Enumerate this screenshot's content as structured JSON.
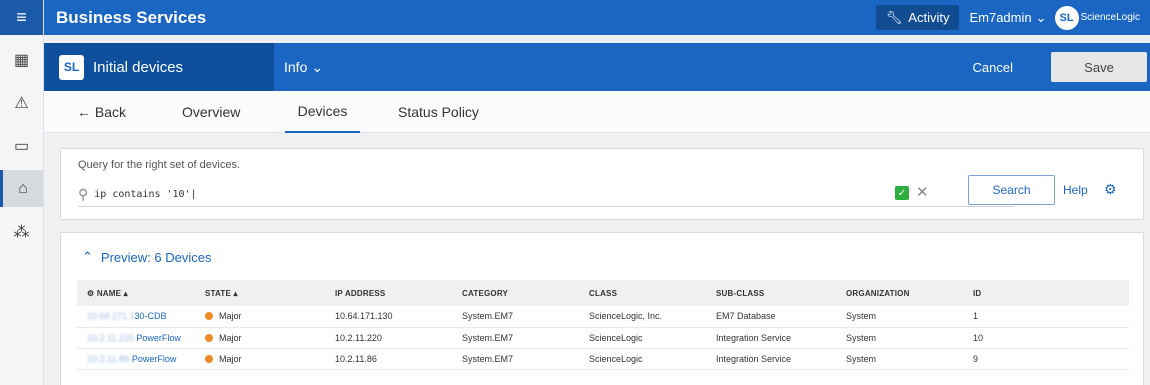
{
  "app": {
    "title": "Business Services",
    "activity_label": "Activity",
    "user_label": "Em7admin",
    "logo_mark": "SL",
    "logo_text": "ScienceLogic"
  },
  "service": {
    "icon_text": "SL",
    "name": "Initial devices",
    "info_label": "Info",
    "cancel_label": "Cancel",
    "save_label": "Save"
  },
  "tabs": {
    "back_label": "← Back",
    "items": [
      "Overview",
      "Devices",
      "Status Policy"
    ],
    "active": "Devices"
  },
  "query": {
    "label": "Query for the right set of devices.",
    "value": "ip contains '10'|",
    "search_label": "Search",
    "help_label": "Help"
  },
  "preview": {
    "title": "Preview: 6 Devices",
    "columns": [
      "NAME ▴",
      "STATE ▴",
      "IP ADDRESS",
      "CATEGORY",
      "CLASS",
      "SUB-CLASS",
      "ORGANIZATION",
      "ID"
    ],
    "rows": [
      {
        "name_prefix": "10.64.171.1",
        "name_suffix": "30-CDB",
        "state": "Major",
        "ip": "10.64.171.130",
        "category": "System.EM7",
        "class": "ScienceLogic, Inc.",
        "subclass": "EM7 Database",
        "org": "System",
        "id": "1"
      },
      {
        "name_prefix": "10.2.11.220",
        "name_suffix": "PowerFlow",
        "state": "Major",
        "ip": "10.2.11.220",
        "category": "System.EM7",
        "class": "ScienceLogic",
        "subclass": "Integration Service",
        "org": "System",
        "id": "10"
      },
      {
        "name_prefix": "10.2.11.86-",
        "name_suffix": "PowerFlow",
        "state": "Major",
        "ip": "10.2.11.86",
        "category": "System.EM7",
        "class": "ScienceLogic",
        "subclass": "Integration Service",
        "org": "System",
        "id": "9"
      }
    ]
  },
  "colors": {
    "brand": "#1a66c2",
    "brand_dark": "#0e4f9e",
    "major": "#f08a24",
    "valid": "#2eae3e"
  },
  "icons": {
    "rail": [
      "menu-icon",
      "dashboard-icon",
      "alert-icon",
      "devices-icon",
      "business-services-icon",
      "topology-icon"
    ]
  }
}
